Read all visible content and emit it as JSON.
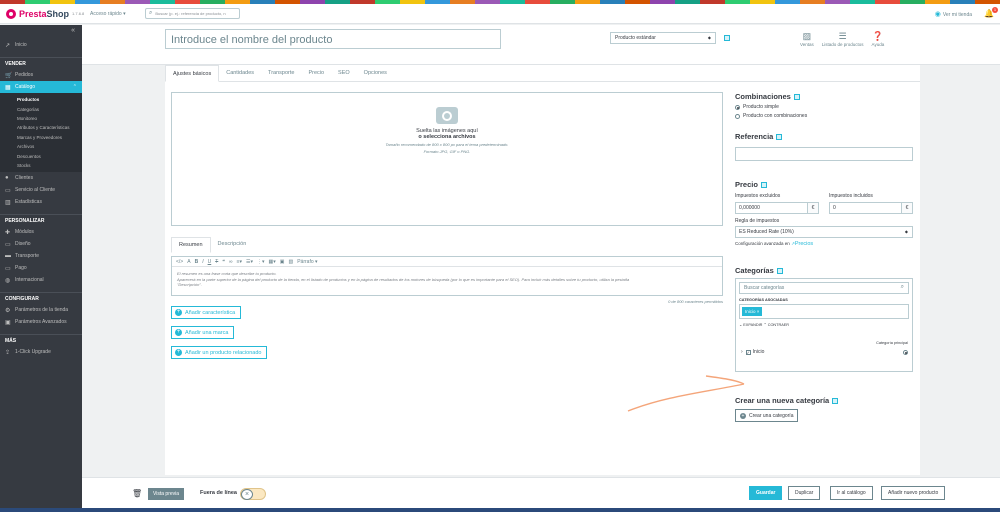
{
  "app": {
    "name_presta": "Presta",
    "name_shop": "Shop",
    "version": "1.7.6.8",
    "quick_access": "Acceso rápido",
    "search_placeholder": "Buscar (p. ej.: referencia de producto, n",
    "view_store": "Ver mi tienda",
    "notifications": "1"
  },
  "taskbar_colors": [
    "#c0392b",
    "#2ecc71",
    "#f1c40f",
    "#3498db",
    "#e67e22",
    "#9b59b6",
    "#1abc9c",
    "#e74c3c",
    "#27ae60",
    "#f39c12",
    "#2980b9",
    "#d35400",
    "#8e44ad",
    "#16a085",
    "#c0392b",
    "#2ecc71",
    "#f1c40f",
    "#3498db",
    "#e67e22",
    "#9b59b6",
    "#1abc9c",
    "#e74c3c",
    "#27ae60",
    "#f39c12",
    "#2980b9",
    "#d35400",
    "#8e44ad",
    "#16a085",
    "#c0392b",
    "#2ecc71",
    "#f1c40f",
    "#3498db",
    "#e67e22",
    "#9b59b6",
    "#1abc9c",
    "#e74c3c",
    "#27ae60",
    "#f39c12",
    "#2980b9",
    "#d35400"
  ],
  "sidebar": {
    "inicio": "Inicio",
    "sections": {
      "vender": "VENDER",
      "personalizar": "PERSONALIZAR",
      "configurar": "CONFIGURAR",
      "mas": "MÁS"
    },
    "vender_items": {
      "pedidos": "Pedidos",
      "catalogo": "Catálogo",
      "clientes": "Clientes",
      "servicio": "Servicio al Cliente",
      "estadisticas": "Estadísticas"
    },
    "catalog_sub": [
      "Productos",
      "Categorías",
      "Monitoreo",
      "Atributos y Características",
      "Marcas y Proveedores",
      "Archivos",
      "Descuentos",
      "Stocks"
    ],
    "personalizar_items": {
      "modulos": "Módulos",
      "diseno": "Diseño",
      "transporte": "Transporte",
      "pago": "Pago",
      "internacional": "Internacional"
    },
    "configurar_items": {
      "tienda": "Parámetros de la tienda",
      "avanzados": "Parámetros Avanzados"
    },
    "mas_items": {
      "upgrade": "1-Click Upgrade"
    }
  },
  "header": {
    "product_name_placeholder": "Introduce el nombre del producto",
    "product_type": "Producto estándar",
    "tools": {
      "ventas": "Ventas",
      "listado": "Listado de productos",
      "ayuda": "Ayuda"
    }
  },
  "tabs": [
    "Ajustes básicos",
    "Cantidades",
    "Transporte",
    "Precio",
    "SEO",
    "Opciones"
  ],
  "dropzone": {
    "line1": "Suelta las imágenes aquí",
    "line2": "o selecciona archivos",
    "line3": "Tamaño recomendado de 800 x 800 px para el tema predeterminado.",
    "line4": "Formato JPG, GIF o PNG."
  },
  "description": {
    "tabs": [
      "Resumen",
      "Descripción"
    ],
    "paragraph_label": "Párrafo",
    "text_line1": "El resumen es una frase corta que describe tu producto.",
    "text_line2": "Aparecerá en la parte superior de la página del producto de la tienda, en el listado de productos y en la página de resultados de los motores de búsqueda (por lo que es importante para el SEO). Para incluir más detalles sobre tu producto, utiliza la pestaña",
    "text_line3": "\"Descripción\".",
    "counter": "0 de 800 caracteres permitidos"
  },
  "add_buttons": {
    "caracteristica": "Añadir característica",
    "marca": "Añadir una marca",
    "relacionado": "Añadir un producto relacionado"
  },
  "combinations": {
    "title": "Combinaciones",
    "simple": "Producto simple",
    "with_combos": "Producto con combinaciones"
  },
  "reference": {
    "title": "Referencia",
    "value": ""
  },
  "price": {
    "title": "Precio",
    "excl_label": "Impuestos excluidos",
    "incl_label": "Impuestos incluidos",
    "excl_value": "0,000000",
    "incl_value": "0",
    "currency": "€",
    "tax_rule_label": "Regla de impuestos",
    "tax_rule_value": "ES Reduced Rate (10%)",
    "advanced_prefix": "Configuración avanzada en",
    "advanced_link": "Precios"
  },
  "categories": {
    "title": "Categorías",
    "search_placeholder": "Buscar categorías",
    "associated_label": "CATEGORÍAS ASOCIADAS",
    "tag": "Inicio",
    "expand": "EXPANDIR",
    "collapse": "CONTRAER",
    "main_category_label": "Categoría principal",
    "tree_item": "Inicio"
  },
  "new_category": {
    "title": "Crear una nueva categoría",
    "button": "Crear una categoría"
  },
  "bottom": {
    "preview": "Vista previa",
    "offline": "Fuera de línea",
    "save": "Guardar",
    "duplicate": "Duplicar",
    "catalog": "Ir al catálogo",
    "add_new": "Añadir nuevo producto"
  },
  "accent_color": "#25b9d7",
  "annotation_color": "#f4a57a"
}
